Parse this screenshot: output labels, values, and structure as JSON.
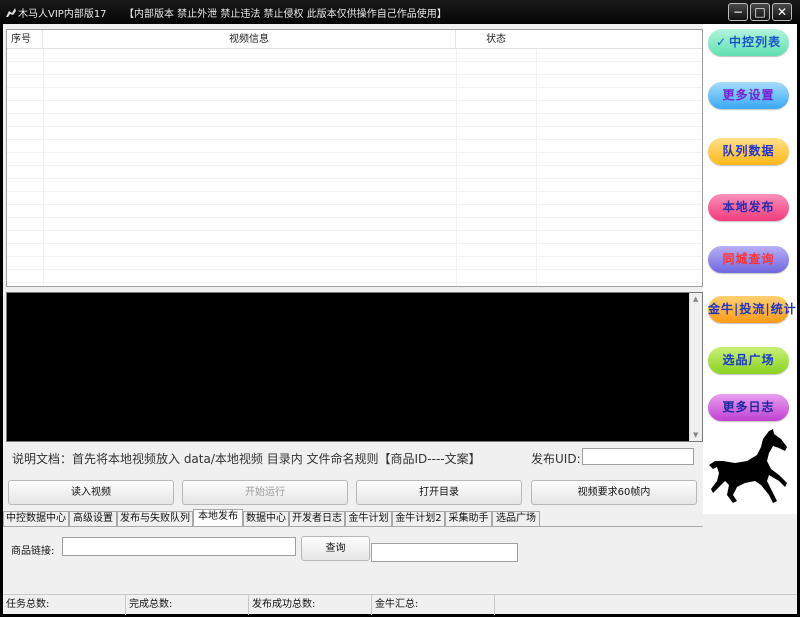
{
  "window": {
    "title": "木马人VIP内部版17",
    "notice": "【内部版本 禁止外泄 禁止违法 禁止侵权 此版本仅供操作自己作品使用】",
    "controls": {
      "minimize": "−",
      "maximize": "□",
      "close": "✕"
    }
  },
  "table": {
    "columns": [
      "序号",
      "视频信息",
      "状态"
    ],
    "rows": []
  },
  "log": {
    "text": ""
  },
  "doc": {
    "text": "说明文档：首先将本地视频放入 data/本地视频 目录内 文件命名规则【商品ID----文案】",
    "uid_label": "发布UID:",
    "uid_value": ""
  },
  "actions": {
    "read_video": "读入视频",
    "start_run": "开始运行",
    "open_dir": "打开目录",
    "video_req": "视频要求60帧内"
  },
  "tabs": [
    {
      "label": "中控数据中心",
      "active": false
    },
    {
      "label": "高级设置",
      "active": false
    },
    {
      "label": "发布与失败队列",
      "active": false
    },
    {
      "label": "本地发布",
      "active": true
    },
    {
      "label": "数据中心",
      "active": false
    },
    {
      "label": "开发者日志",
      "active": false
    },
    {
      "label": "金牛计划",
      "active": false
    },
    {
      "label": "金牛计划2",
      "active": false
    },
    {
      "label": "采集助手",
      "active": false
    },
    {
      "label": "选品广场",
      "active": false
    }
  ],
  "panel": {
    "link_label": "商品链接:",
    "link_value": "",
    "query": "查询",
    "result": ""
  },
  "status": [
    "任务总数:",
    "完成总数:",
    "发布成功总数:",
    "金牛汇总:"
  ],
  "sidebar": {
    "items": [
      {
        "label": "中控列表",
        "check": "✓",
        "bg": "#5fe0b0",
        "bg2": "#b4f4dc",
        "color": "#1a55c8"
      },
      {
        "label": "更多设置",
        "check": "",
        "bg": "#38a8f4",
        "bg2": "#a8dcfa",
        "color": "#7a1fd0"
      },
      {
        "label": "队列数据",
        "check": "",
        "bg": "#ffb81a",
        "bg2": "#ffe08a",
        "color": "#2233cc"
      },
      {
        "label": "本地发布",
        "check": "",
        "bg": "#f23c7c",
        "bg2": "#f890b8",
        "color": "#2b2bb0"
      },
      {
        "label": "同城查询",
        "check": "",
        "bg": "#7066e0",
        "bg2": "#b8b0f4",
        "color": "#ff3333"
      },
      {
        "label": "金牛|投流|统计",
        "check": "",
        "bg": "#ff9a1a",
        "bg2": "#ffd070",
        "color": "#1a38c8"
      },
      {
        "label": "选品广场",
        "check": "",
        "bg": "#8ad220",
        "bg2": "#c8f078",
        "color": "#1a38c8"
      },
      {
        "label": "更多日志",
        "check": "",
        "bg": "#c040d0",
        "bg2": "#e8a0f0",
        "color": "#1a2aa0"
      }
    ]
  },
  "colors": {
    "titlebar": "#0a0a0a",
    "log_bg": "#000000",
    "client_bg": "#f0f0f0"
  }
}
